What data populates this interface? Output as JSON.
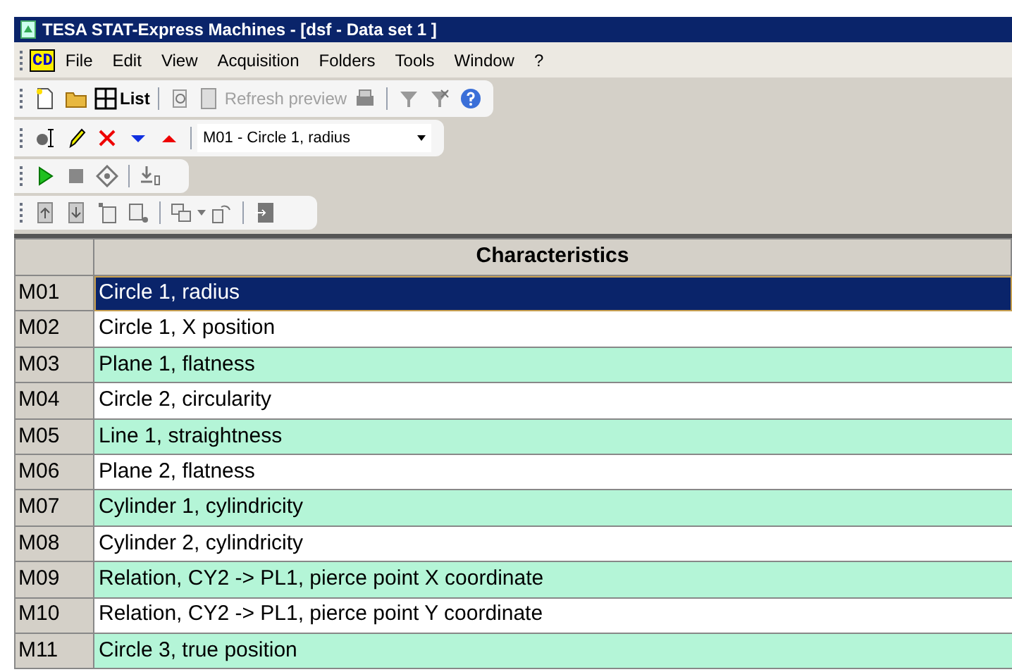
{
  "window": {
    "title": "TESA STAT-Express Machines - [dsf - Data set 1 ]"
  },
  "menu": {
    "logo": "CD",
    "items": [
      "File",
      "Edit",
      "View",
      "Acquisition",
      "Folders",
      "Tools",
      "Window",
      "?"
    ]
  },
  "toolbar": {
    "list_label": "List",
    "refresh": {
      "label": "Refresh preview",
      "disabled": true
    },
    "characteristic_combo": "M01 - Circle 1, radius"
  },
  "table": {
    "columns": [
      "Characteristics"
    ],
    "rows": [
      {
        "id": "M01",
        "name": "Circle 1, radius",
        "selected": true,
        "color": "#0a246a"
      },
      {
        "id": "M02",
        "name": "Circle 1, X position",
        "selected": false,
        "color": "#ffffff"
      },
      {
        "id": "M03",
        "name": "Plane 1, flatness",
        "selected": false,
        "color": "#b4f5d7"
      },
      {
        "id": "M04",
        "name": "Circle 2, circularity",
        "selected": false,
        "color": "#ffffff"
      },
      {
        "id": "M05",
        "name": "Line 1, straightness",
        "selected": false,
        "color": "#b4f5d7"
      },
      {
        "id": "M06",
        "name": "Plane 2, flatness",
        "selected": false,
        "color": "#ffffff"
      },
      {
        "id": "M07",
        "name": "Cylinder 1, cylindricity",
        "selected": false,
        "color": "#b4f5d7"
      },
      {
        "id": "M08",
        "name": "Cylinder 2, cylindricity",
        "selected": false,
        "color": "#ffffff"
      },
      {
        "id": "M09",
        "name": "Relation, CY2 -> PL1, pierce point X coordinate",
        "selected": false,
        "color": "#b4f5d7"
      },
      {
        "id": "M10",
        "name": "Relation, CY2 -> PL1, pierce point Y coordinate",
        "selected": false,
        "color": "#ffffff"
      },
      {
        "id": "M11",
        "name": "Circle 3, true position",
        "selected": false,
        "color": "#b4f5d7"
      }
    ]
  }
}
